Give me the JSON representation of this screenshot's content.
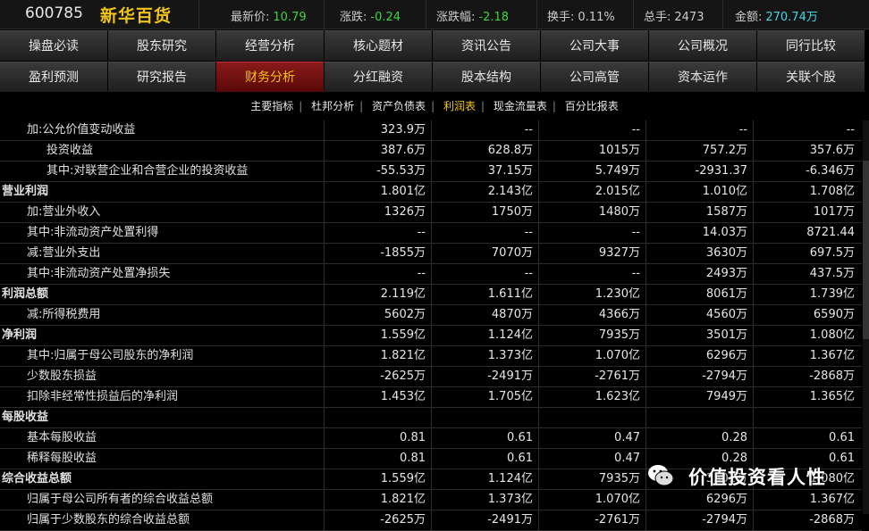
{
  "header": {
    "code": "600785",
    "name": "新华百货",
    "quotes": [
      {
        "label": "最新价:",
        "value": "10.79"
      },
      {
        "label": "涨跌:",
        "value": "-0.24"
      },
      {
        "label": "涨跌幅:",
        "value": "-2.18"
      },
      {
        "label": "换手:",
        "value": "0.11%"
      },
      {
        "label": "总手:",
        "value": "2473"
      },
      {
        "label": "金额:",
        "value": "270.74万"
      }
    ]
  },
  "nav": {
    "row1": [
      "操盘必读",
      "股东研究",
      "经营分析",
      "核心题材",
      "资讯公告",
      "公司大事",
      "公司概况",
      "同行比较"
    ],
    "row2": [
      "盈利预测",
      "研究报告",
      "财务分析",
      "分红融资",
      "股本结构",
      "公司高管",
      "资本运作",
      "关联个股"
    ],
    "active": "财务分析"
  },
  "subtabs": {
    "items": [
      "主要指标",
      "杜邦分析",
      "资产负债表",
      "利润表",
      "现金流量表",
      "百分比报表"
    ],
    "active": "利润表"
  },
  "rows": [
    {
      "label": "加:公允价值变动收益",
      "level": 1,
      "values": [
        "323.9万",
        "--",
        "--",
        "--",
        "--"
      ]
    },
    {
      "label": "投资收益",
      "level": 2,
      "values": [
        "387.6万",
        "628.8万",
        "1015万",
        "757.2万",
        "357.6万"
      ]
    },
    {
      "label": "其中:对联营企业和合营企业的投资收益",
      "level": 2,
      "values": [
        "-55.53万",
        "37.15万",
        "5.749万",
        "-2931.37",
        "-6.346万"
      ]
    },
    {
      "label": "营业利润",
      "level": 0,
      "values": [
        "1.801亿",
        "2.143亿",
        "2.015亿",
        "1.010亿",
        "1.708亿"
      ]
    },
    {
      "label": "加:营业外收入",
      "level": 1,
      "values": [
        "1326万",
        "1750万",
        "1480万",
        "1587万",
        "1017万"
      ]
    },
    {
      "label": "其中:非流动资产处置利得",
      "level": 1,
      "values": [
        "--",
        "--",
        "--",
        "14.03万",
        "8721.44"
      ]
    },
    {
      "label": "减:营业外支出",
      "level": 1,
      "values": [
        "-1855万",
        "7070万",
        "9327万",
        "3630万",
        "697.5万"
      ]
    },
    {
      "label": "其中:非流动资产处置净损失",
      "level": 1,
      "values": [
        "--",
        "--",
        "--",
        "2493万",
        "437.5万"
      ]
    },
    {
      "label": "利润总额",
      "level": 0,
      "values": [
        "2.119亿",
        "1.611亿",
        "1.230亿",
        "8061万",
        "1.739亿"
      ]
    },
    {
      "label": "减:所得税费用",
      "level": 1,
      "values": [
        "5602万",
        "4870万",
        "4366万",
        "4560万",
        "6590万"
      ]
    },
    {
      "label": "净利润",
      "level": 0,
      "values": [
        "1.559亿",
        "1.124亿",
        "7935万",
        "3501万",
        "1.080亿"
      ]
    },
    {
      "label": "其中:归属于母公司股东的净利润",
      "level": 1,
      "values": [
        "1.821亿",
        "1.373亿",
        "1.070亿",
        "6296万",
        "1.367亿"
      ]
    },
    {
      "label": "少数股东损益",
      "level": 1,
      "values": [
        "-2625万",
        "-2491万",
        "-2761万",
        "-2794万",
        "-2868万"
      ]
    },
    {
      "label": "扣除非经常性损益后的净利润",
      "level": 1,
      "values": [
        "1.453亿",
        "1.705亿",
        "1.623亿",
        "7949万",
        "1.365亿"
      ]
    },
    {
      "label": "每股收益",
      "level": 0,
      "values": [
        "",
        "",
        "",
        "",
        ""
      ]
    },
    {
      "label": "基本每股收益",
      "level": 1,
      "values": [
        "0.81",
        "0.61",
        "0.47",
        "0.28",
        "0.61"
      ]
    },
    {
      "label": "稀释每股收益",
      "level": 1,
      "values": [
        "0.81",
        "0.61",
        "0.47",
        "0.28",
        "0.61"
      ]
    },
    {
      "label": "综合收益总额",
      "level": 0,
      "values": [
        "1.559亿",
        "1.124亿",
        "7935万",
        "3501万",
        "1.080亿"
      ]
    },
    {
      "label": "归属于母公司所有者的综合收益总额",
      "level": 1,
      "values": [
        "1.821亿",
        "1.373亿",
        "1.070亿",
        "6296万",
        "1.367亿"
      ]
    },
    {
      "label": "归属于少数股东的综合收益总额",
      "level": 1,
      "values": [
        "-2625万",
        "-2491万",
        "-2761万",
        "-2794万",
        "-2868万"
      ]
    }
  ],
  "watermark": {
    "text": "价值投资看人性",
    "icon": "wechat-icon"
  },
  "colors": {
    "accent": "#f0c419",
    "active_tab_bg": "#7a1010",
    "green": "#3cd43c",
    "cyan": "#44d6e6"
  }
}
